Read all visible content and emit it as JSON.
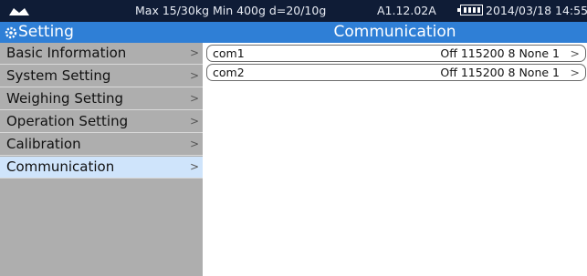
{
  "status": {
    "spec": "Max 15/30kg  Min 400g  d=20/10g",
    "firmware": "A1.12.02A",
    "datetime": "2014/03/18  14:55"
  },
  "sidebar": {
    "title": "Setting",
    "items": [
      {
        "label": "Basic Information"
      },
      {
        "label": "System Setting"
      },
      {
        "label": "Weighing Setting"
      },
      {
        "label": "Operation Setting"
      },
      {
        "label": "Calibration"
      },
      {
        "label": "Communication",
        "selected": true
      }
    ]
  },
  "content": {
    "title": "Communication",
    "rows": [
      {
        "name": "com1",
        "value": "Off 115200 8 None 1"
      },
      {
        "name": "com2",
        "value": "Off 115200 8 None 1"
      }
    ]
  },
  "icons": {
    "chevron": ">",
    "brand_logo": "brand-logo-icon",
    "battery": "battery-icon",
    "settings": "gear-icon"
  },
  "colors": {
    "status_bar": "#0f1c36",
    "header_blue": "#2f7fd6",
    "sidebar_gray": "#aeaeae",
    "selected_item": "#cfe4fb"
  }
}
